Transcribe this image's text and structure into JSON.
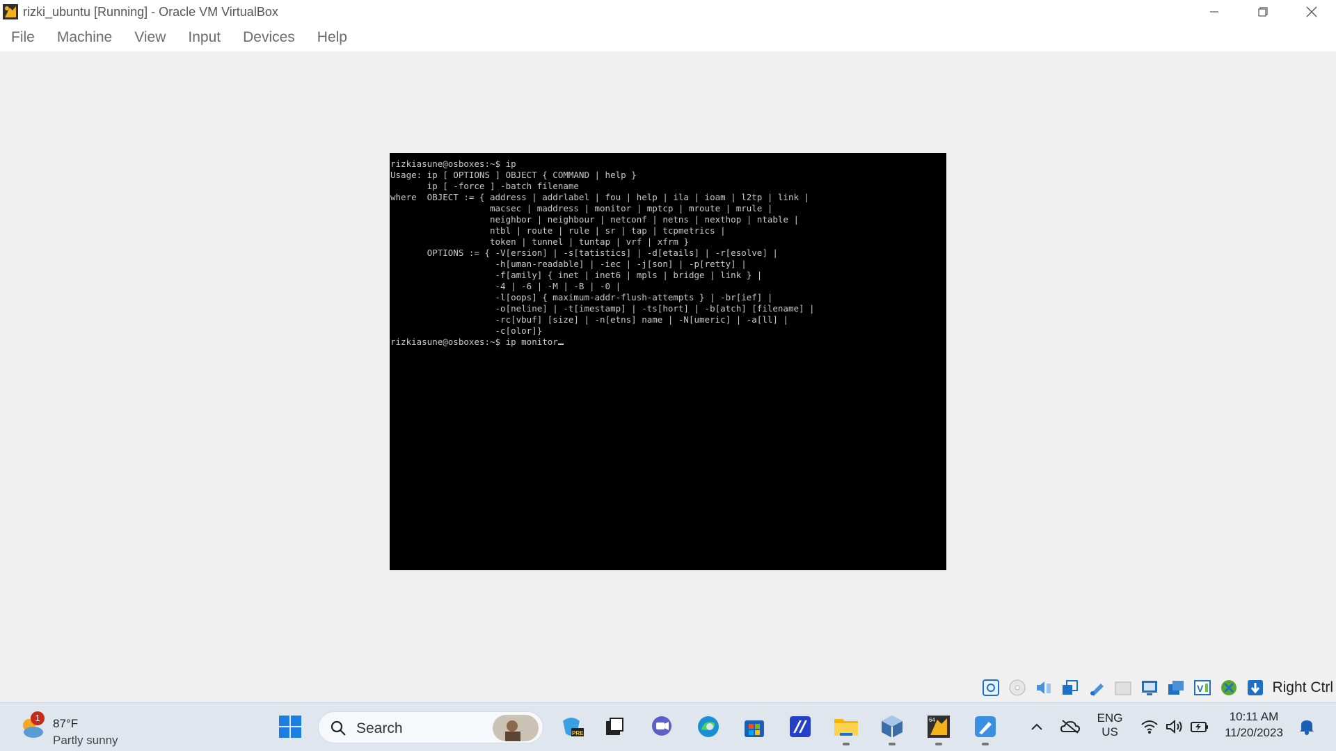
{
  "window": {
    "title": "rizki_ubuntu [Running] - Oracle VM VirtualBox"
  },
  "menu": [
    "File",
    "Machine",
    "View",
    "Input",
    "Devices",
    "Help"
  ],
  "terminal": {
    "lines": [
      "rizkiasune@osboxes:~$ ip",
      "Usage: ip [ OPTIONS ] OBJECT { COMMAND | help }",
      "       ip [ -force ] -batch filename",
      "where  OBJECT := { address | addrlabel | fou | help | ila | ioam | l2tp | link |",
      "                   macsec | maddress | monitor | mptcp | mroute | mrule |",
      "                   neighbor | neighbour | netconf | netns | nexthop | ntable |",
      "                   ntbl | route | rule | sr | tap | tcpmetrics |",
      "                   token | tunnel | tuntap | vrf | xfrm }",
      "       OPTIONS := { -V[ersion] | -s[tatistics] | -d[etails] | -r[esolve] |",
      "                    -h[uman-readable] | -iec | -j[son] | -p[retty] |",
      "                    -f[amily] { inet | inet6 | mpls | bridge | link } |",
      "                    -4 | -6 | -M | -B | -0 |",
      "                    -l[oops] { maximum-addr-flush-attempts } | -br[ief] |",
      "                    -o[neline] | -t[imestamp] | -ts[hort] | -b[atch] [filename] |",
      "                    -rc[vbuf] [size] | -n[etns] name | -N[umeric] | -a[ll] |",
      "                    -c[olor]}",
      "rizkiasune@osboxes:~$ ip monitor"
    ]
  },
  "statusbar": {
    "host_key": "Right Ctrl",
    "icons": [
      "hard-disk-icon",
      "optical-disk-icon",
      "audio-icon",
      "network-icon",
      "usb-icon",
      "shared-folder-icon",
      "display-icon",
      "recording-icon",
      "cpu-icon",
      "mouse-integration-icon",
      "keyboard-capture-icon"
    ]
  },
  "taskbar": {
    "weather": {
      "temp": "87°F",
      "desc": "Partly sunny",
      "badge": "1"
    },
    "search_label": "Search",
    "language": {
      "line1": "ENG",
      "line2": "US"
    },
    "clock": {
      "time": "10:11 AM",
      "date": "11/20/2023"
    }
  },
  "colors": {
    "terminal_bg": "#000000",
    "terminal_fg": "#c8c8c8",
    "taskbar_bg": "#dfe6ee",
    "window_bg": "#f0f0f0"
  }
}
